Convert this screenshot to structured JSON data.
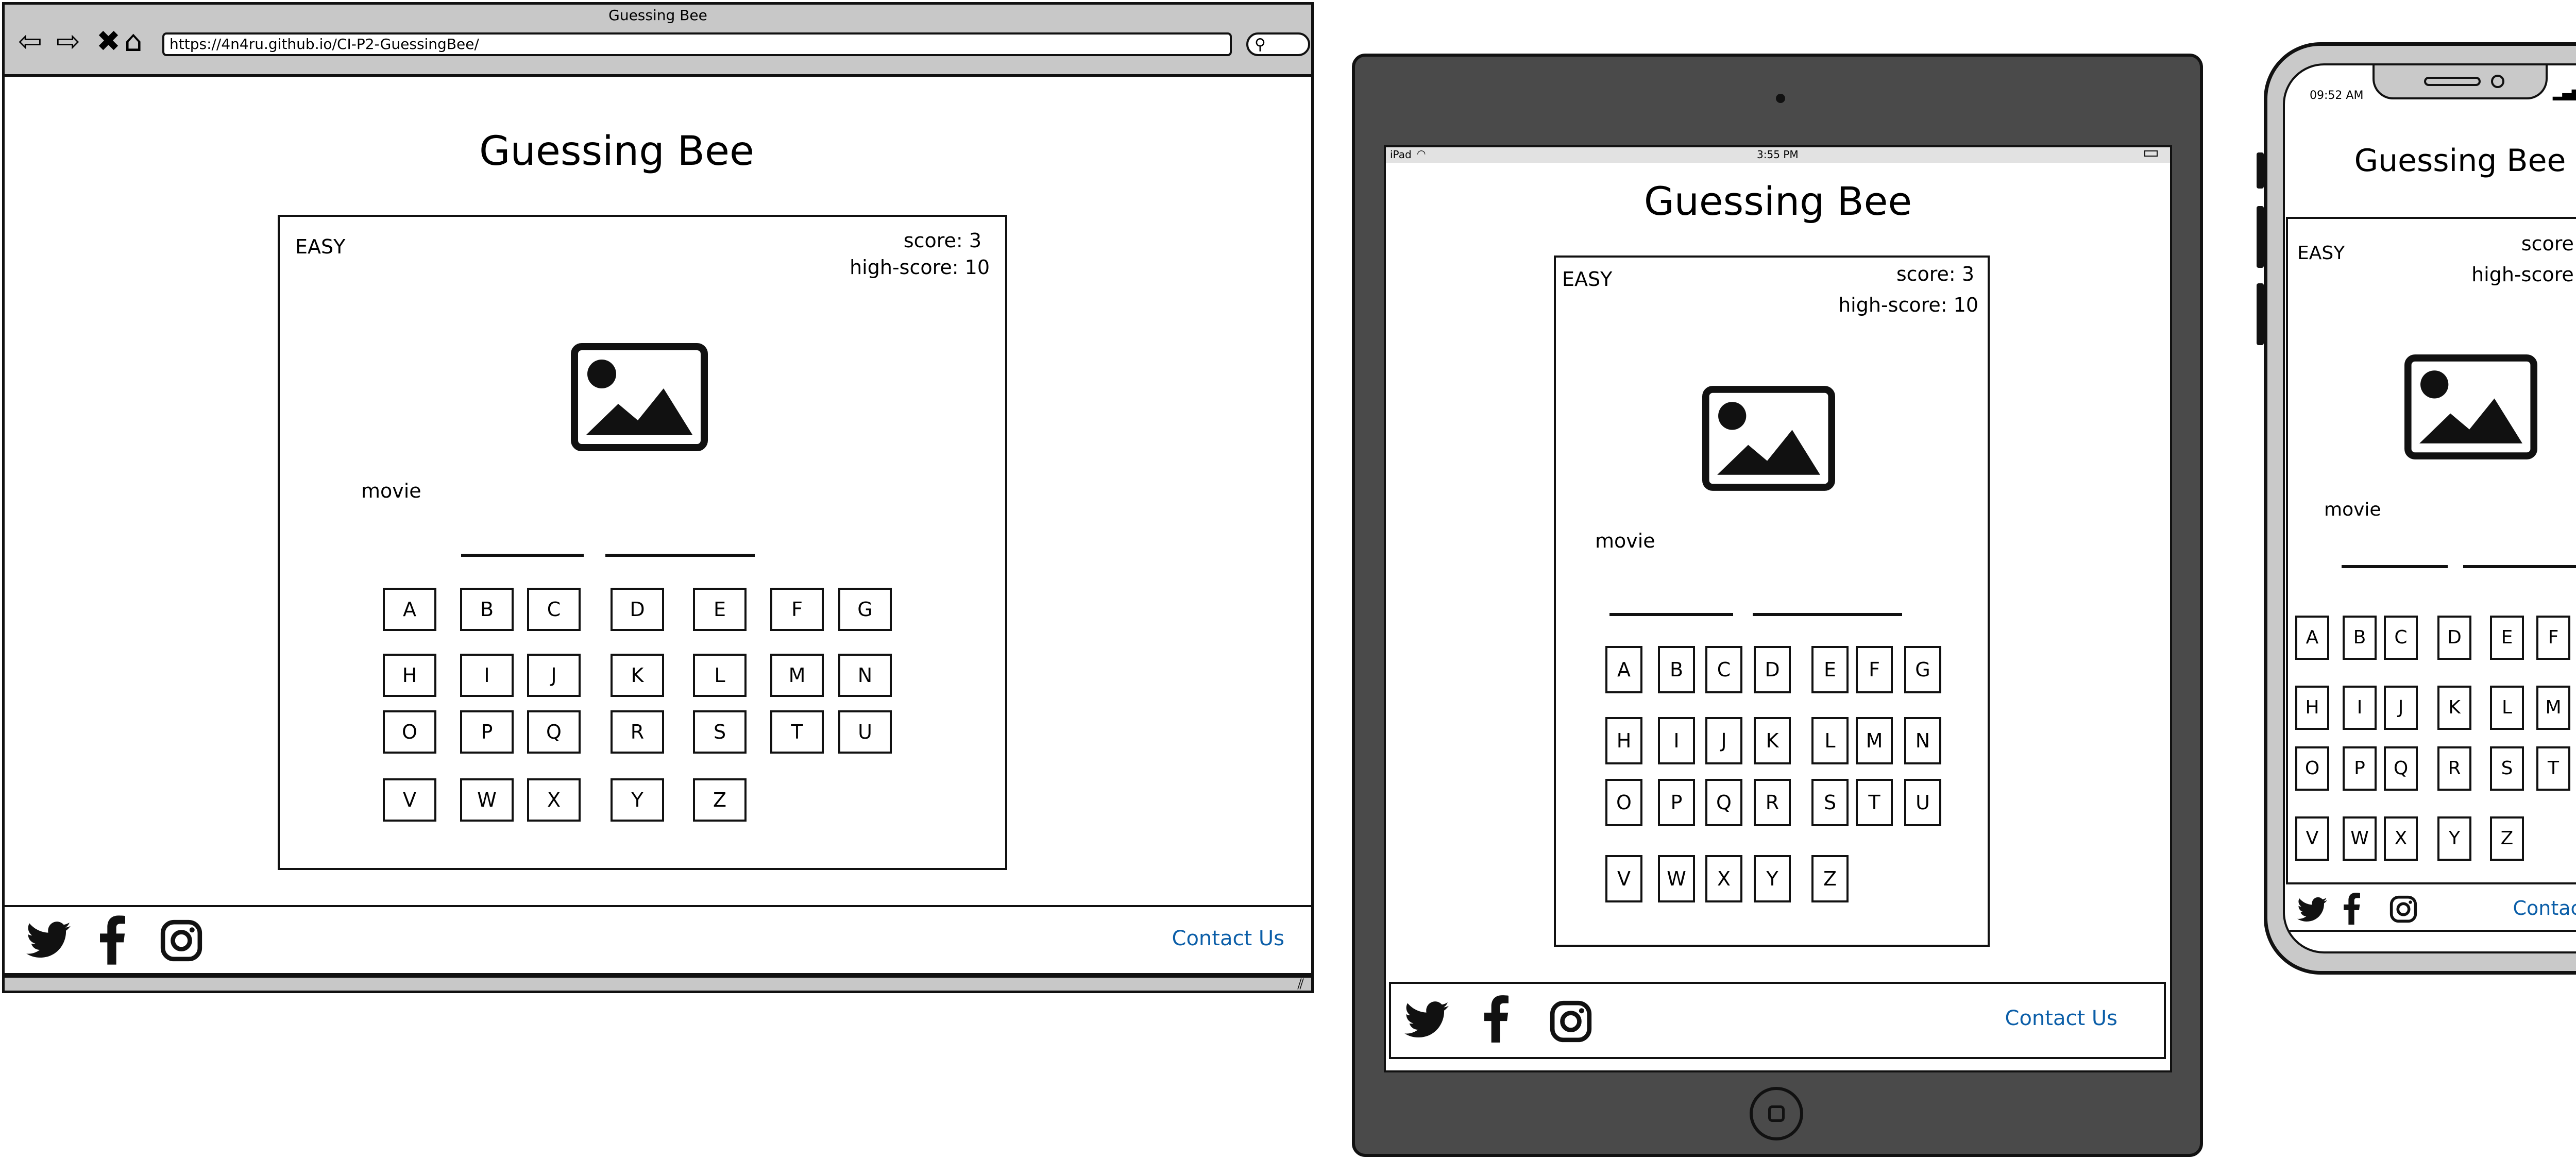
{
  "browser": {
    "window_title": "Guessing Bee",
    "url": "https://4n4ru.github.io/CI-P2-GuessingBee/",
    "nav_icons": [
      "back-arrow-icon",
      "forward-arrow-icon",
      "stop-icon",
      "home-icon"
    ],
    "search_icon": "search-icon"
  },
  "app": {
    "title": "Guessing Bee",
    "difficulty": "EASY",
    "score": "score: 3",
    "high_score": "high-score: 10",
    "category": "movie",
    "word_blanks": [
      5,
      6
    ],
    "keys": [
      [
        "A",
        "B",
        "C",
        "D",
        "E",
        "F",
        "G"
      ],
      [
        "H",
        "I",
        "J",
        "K",
        "L",
        "M",
        "N"
      ],
      [
        "O",
        "P",
        "Q",
        "R",
        "S",
        "T",
        "U"
      ],
      [
        "V",
        "W",
        "X",
        "Y",
        "Z"
      ]
    ],
    "image_placeholder_icon": "image-placeholder-icon",
    "footer": {
      "social_icons": [
        "twitter-icon",
        "facebook-icon",
        "instagram-icon"
      ],
      "contact": "Contact Us"
    }
  },
  "ipad": {
    "device_label": "iPad",
    "time": "3:55 PM"
  },
  "phone": {
    "time": "09:52 AM"
  },
  "colors": {
    "link": "#0b5ea8",
    "ipad_body": "#4a4a4a",
    "browser_chrome": "#c8c8c8",
    "phone_body": "#c9c9c9"
  }
}
